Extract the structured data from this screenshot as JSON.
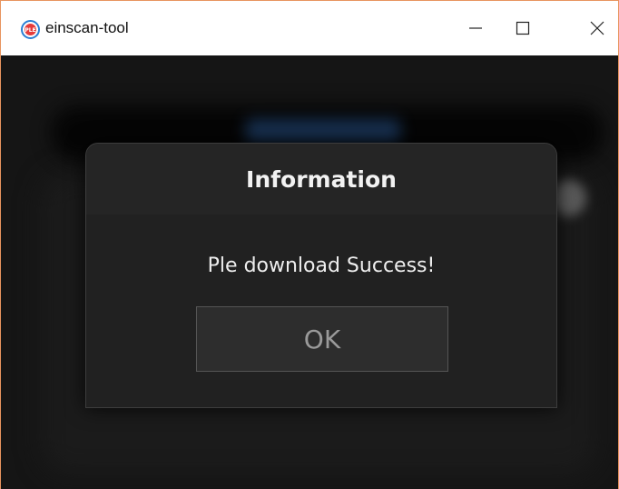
{
  "window": {
    "title": "einscan-tool",
    "icon": "ple-logo-icon",
    "controls": [
      "minimize-icon",
      "maximize-icon",
      "close-icon"
    ]
  },
  "dialog": {
    "title": "Information",
    "message": "Ple download Success!",
    "ok_label": "OK"
  },
  "colors": {
    "window_border": "#e8955f",
    "background": "#151515",
    "dialog_bg": "#212121",
    "button_bg": "#2d2d2d",
    "button_text": "#9a9a9a"
  }
}
